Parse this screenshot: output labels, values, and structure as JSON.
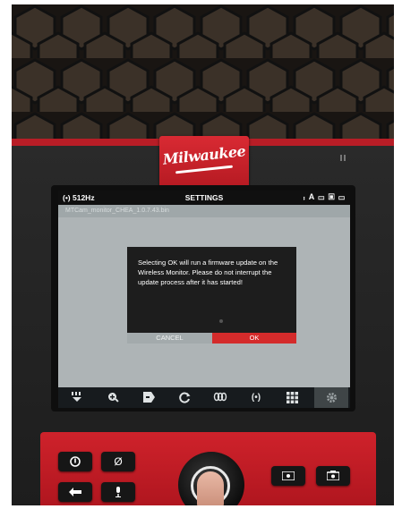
{
  "brand": {
    "logo_text": "Milwaukee"
  },
  "status_bar": {
    "frequency": "(•) 512Hz",
    "title": "SETTINGS",
    "indicators": [
      "wifi-icon",
      "auto-icon",
      "battery-icon",
      "sd-card-icon",
      "battery-icon"
    ]
  },
  "firmware_file": "MTCam_monitor_CHEA_1.0.7.43.bin",
  "dialog": {
    "message": "Selecting OK will run a firmware update on the Wireless Monitor. Please do not interrupt the update process after it has started!",
    "cancel_label": "CANCEL",
    "ok_label": "OK"
  },
  "toolbar": {
    "items": [
      {
        "icon": "menu-down-icon"
      },
      {
        "icon": "zoom-icon"
      },
      {
        "icon": "tag-icon"
      },
      {
        "icon": "rotate-icon"
      },
      {
        "icon": "sonde-icon"
      },
      {
        "icon": "locate-icon",
        "label": "(•)"
      },
      {
        "icon": "grid-icon"
      },
      {
        "icon": "settings-gear-icon"
      }
    ]
  },
  "hardware_buttons": {
    "power": "power-icon",
    "no_symbol": "Ø",
    "back": "back-arrow-icon",
    "microphone": "microphone-icon",
    "video": "video-record-icon",
    "photo": "camera-icon"
  },
  "colors": {
    "brand_red": "#c8202a",
    "ok_button": "#d42b2b",
    "screen_bg": "#aeb4b6",
    "dialog_bg": "#1d1d1d"
  }
}
